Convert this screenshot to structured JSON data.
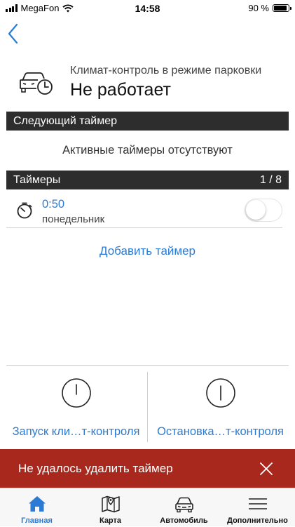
{
  "status_bar": {
    "carrier": "MegaFon",
    "time": "14:58",
    "battery_text": "90 %",
    "battery_level": 0.9
  },
  "header": {
    "subtitle": "Климат-контроль в режиме парковки",
    "status": "Не работает"
  },
  "next_timer": {
    "title": "Следующий таймер",
    "empty_text": "Активные таймеры отсутствуют"
  },
  "timers": {
    "title": "Таймеры",
    "count": "1 / 8",
    "items": [
      {
        "time": "0:50",
        "day": "понедельник",
        "enabled": false
      }
    ],
    "add_label": "Добавить таймер"
  },
  "actions": {
    "start_label": "Запуск кли…т-контроля",
    "stop_label": "Остановка…т-контроля"
  },
  "error": {
    "message": "Не удалось удалить таймер"
  },
  "tabs": [
    {
      "label": "Главная",
      "icon": "home-icon",
      "active": true
    },
    {
      "label": "Карта",
      "icon": "map-icon",
      "active": false
    },
    {
      "label": "Автомобиль",
      "icon": "car-icon",
      "active": false
    },
    {
      "label": "Дополнительно",
      "icon": "menu-icon",
      "active": false
    }
  ],
  "colors": {
    "accent": "#2b7bd4",
    "section_bar": "#2d2d2d",
    "error_banner": "#a8281e"
  }
}
